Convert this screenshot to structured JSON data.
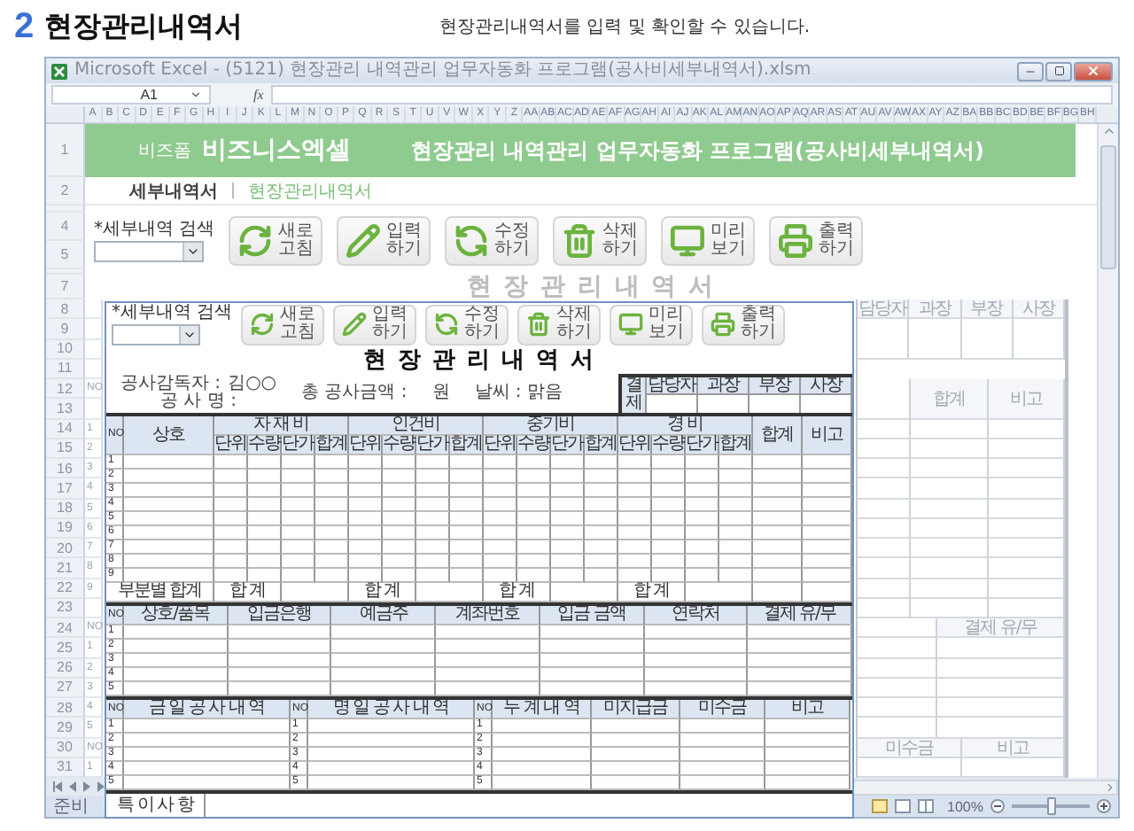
{
  "header": {
    "number": "2",
    "title": "현장관리내역서",
    "description": "현장관리내역서를 입력 및 확인할 수 있습니다."
  },
  "excel": {
    "title": "Microsoft Excel - (5121) 현장관리 내역관리 업무자동화 프로그램(공사비세부내역서).xlsm",
    "name_box": "A1",
    "fx": "fx",
    "columns": [
      "A",
      "B",
      "C",
      "D",
      "E",
      "F",
      "G",
      "H",
      "I",
      "J",
      "K",
      "L",
      "M",
      "N",
      "O",
      "P",
      "Q",
      "R",
      "S",
      "T",
      "U",
      "V",
      "W",
      "X",
      "Y",
      "Z",
      "AA",
      "AB",
      "AC",
      "AD",
      "AE",
      "AF",
      "AG",
      "AH",
      "AI",
      "AJ",
      "AK",
      "AL",
      "AM",
      "AN",
      "AO",
      "AP",
      "AQ",
      "AR",
      "AS",
      "AT",
      "AU",
      "AV",
      "AW",
      "AX",
      "AY",
      "AZ",
      "BA",
      "BB",
      "BC",
      "BD",
      "BE",
      "BF",
      "BG",
      "BH"
    ],
    "banner": {
      "row": "1",
      "brand_small": "비즈폼",
      "brand": "비즈니스엑셀",
      "title": "현장관리 내역관리 업무자동화 프로그램(공사비세부내역서)"
    },
    "tabs_row": {
      "row": "2",
      "tabs": [
        {
          "label": "세부내역서",
          "selected": false
        },
        {
          "label": "현장관리내역서",
          "selected": true
        }
      ]
    },
    "toolbar": {
      "rows": [
        "4",
        "5"
      ],
      "search_label": "*세부내역 검색",
      "buttons": [
        {
          "kind": "refresh",
          "lines": [
            "새로",
            "고침"
          ]
        },
        {
          "kind": "edit",
          "lines": [
            "입력",
            "하기"
          ]
        },
        {
          "kind": "update",
          "lines": [
            "수정",
            "하기"
          ]
        },
        {
          "kind": "delete",
          "lines": [
            "삭제",
            "하기"
          ]
        },
        {
          "kind": "preview",
          "lines": [
            "미리",
            "보기"
          ]
        },
        {
          "kind": "print",
          "lines": [
            "출력",
            "하기"
          ]
        }
      ]
    },
    "title_row": {
      "row": "7",
      "title": "현 장 관 리 내 역 서"
    },
    "grid_rows": [
      {
        "row": "8"
      },
      {
        "row": "9"
      },
      {
        "row": "10"
      },
      {
        "row": "11"
      },
      {
        "row": "12",
        "b": "NO"
      },
      {
        "row": "13"
      },
      {
        "row": "14",
        "b": "1"
      },
      {
        "row": "15",
        "b": "2"
      },
      {
        "row": "16",
        "b": "3"
      },
      {
        "row": "17",
        "b": "4"
      },
      {
        "row": "18",
        "b": "5"
      },
      {
        "row": "19",
        "b": "6"
      },
      {
        "row": "20",
        "b": "7"
      },
      {
        "row": "21",
        "b": "8"
      },
      {
        "row": "22",
        "b": "9"
      },
      {
        "row": "23"
      },
      {
        "row": "24",
        "b": "NO"
      },
      {
        "row": "25",
        "b": "1"
      },
      {
        "row": "26",
        "b": "2"
      },
      {
        "row": "27",
        "b": "3"
      },
      {
        "row": "28",
        "b": "4"
      },
      {
        "row": "29",
        "b": "5"
      },
      {
        "row": "30",
        "b": "NO"
      },
      {
        "row": "31",
        "b": "1"
      }
    ],
    "right_panel": {
      "approval": [
        "담당자",
        "과장",
        "부장",
        "사장"
      ],
      "main_header": [
        "합계",
        "비고"
      ],
      "bank_header": "결제 유/무",
      "work_header": [
        "미수금",
        "비고"
      ]
    },
    "status": {
      "text": "준비",
      "zoom": "100%",
      "level": 0.5
    }
  },
  "form": {
    "toolbar": {
      "search_label": "*세부내역 검색",
      "buttons": [
        {
          "kind": "refresh",
          "lines": [
            "새로",
            "고침"
          ]
        },
        {
          "kind": "edit",
          "lines": [
            "입력",
            "하기"
          ]
        },
        {
          "kind": "update",
          "lines": [
            "수정",
            "하기"
          ]
        },
        {
          "kind": "delete",
          "lines": [
            "삭제",
            "하기"
          ]
        },
        {
          "kind": "preview",
          "lines": [
            "미리",
            "보기"
          ]
        },
        {
          "kind": "print",
          "lines": [
            "출력",
            "하기"
          ]
        }
      ]
    },
    "title": "현 장 관 리 내 역 서",
    "info": {
      "supervisor_label": "공사감독자 :",
      "supervisor": "김○○",
      "project_label": "공 사 명 :",
      "amount_label": "총 공사금액 :",
      "currency": "원",
      "weather": "날씨 : 맑음"
    },
    "approval": {
      "label": "결제",
      "roles": [
        "담당자",
        "과장",
        "부장",
        "사장"
      ]
    },
    "main_table": {
      "no": "NO",
      "name": "상호",
      "groups": [
        {
          "label": "자 재 비",
          "subs": [
            "단위",
            "수량",
            "단가",
            "합계"
          ]
        },
        {
          "label": "인건비",
          "subs": [
            "단위",
            "수량",
            "단가",
            "합계"
          ]
        },
        {
          "label": "중기비",
          "subs": [
            "단위",
            "수량",
            "단가",
            "합계"
          ]
        },
        {
          "label": "경 비",
          "subs": [
            "단위",
            "수량",
            "단가",
            "합계"
          ]
        }
      ],
      "total": "합계",
      "note": "비고",
      "rows": [
        "1",
        "2",
        "3",
        "4",
        "5",
        "6",
        "7",
        "8",
        "9"
      ],
      "subtotal_label": "부분별 합계",
      "subtotals": [
        "합 계",
        "합 계",
        "합 계",
        "합 계"
      ]
    },
    "bank_table": {
      "columns": [
        "NO",
        "상호/품목",
        "입금은행",
        "예금주",
        "계좌번호",
        "입금 금액",
        "연락처",
        "결제 유/무"
      ],
      "rows": [
        "1",
        "2",
        "3",
        "4",
        "5"
      ]
    },
    "work_table": {
      "sections": [
        {
          "no": "NO",
          "label": "금 일 공 사 내 역",
          "rows": [
            "1",
            "2",
            "3",
            "4",
            "5"
          ]
        },
        {
          "no": "NO",
          "label": "명 일 공 사 내 역",
          "rows": [
            "1",
            "2",
            "3",
            "4",
            "5"
          ]
        },
        {
          "no": "NO",
          "label": "누 계 내 역",
          "rows": [
            "1",
            "2",
            "3",
            "4",
            "5"
          ]
        }
      ],
      "extra": [
        "미지급금",
        "미수금",
        "비고"
      ]
    },
    "remarks": "특 이 사 항"
  }
}
